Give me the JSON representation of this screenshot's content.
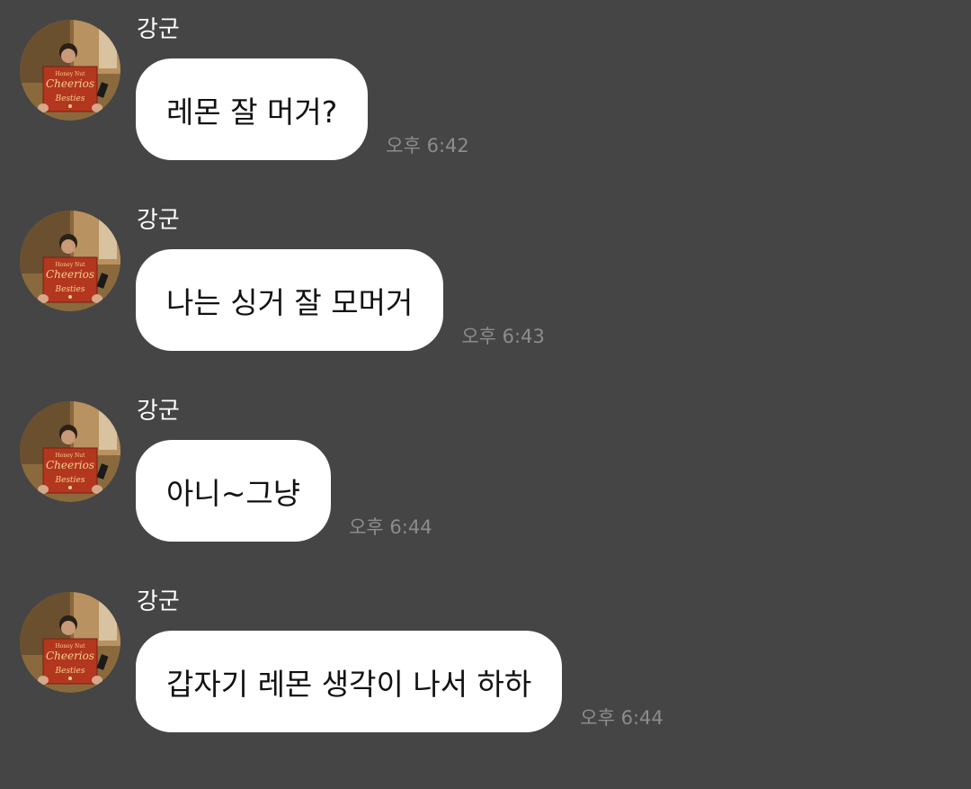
{
  "messages": [
    {
      "sender": "강군",
      "text": "레몬 잘 머거?",
      "time": "오후 6:42"
    },
    {
      "sender": "강군",
      "text": "나는 싱거 잘 모머거",
      "time": "오후 6:43"
    },
    {
      "sender": "강군",
      "text": "아니~그냥",
      "time": "오후 6:44"
    },
    {
      "sender": "강군",
      "text": "갑자기 레몬 생각이 나서 하하",
      "time": "오후 6:44"
    }
  ],
  "avatar": {
    "box_lettering": [
      "Honey Nut",
      "Cheerios",
      "Besties"
    ]
  },
  "colors": {
    "background": "#454545",
    "bubble": "#ffffff",
    "time_text": "#8c8c8c",
    "sender_text": "#ffffff"
  }
}
